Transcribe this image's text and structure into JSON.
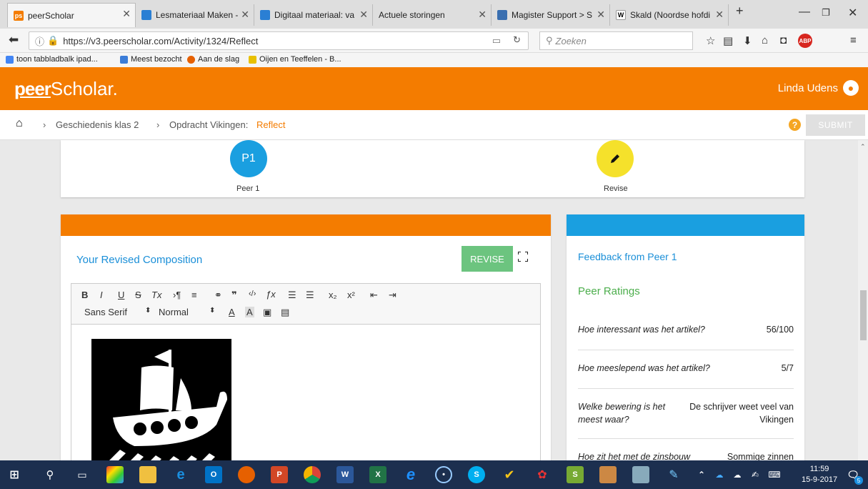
{
  "browser": {
    "tabs": [
      {
        "label": "peerScholar",
        "icon_color": "#f47c00",
        "icon_text": "ps",
        "active": true
      },
      {
        "label": "Lesmateriaal Maken -",
        "icon_color": "#2a7fd4",
        "icon_text": "",
        "active": false
      },
      {
        "label": "Digitaal materiaal: va",
        "icon_color": "#2a7fd4",
        "icon_text": "",
        "active": false
      },
      {
        "label": "Actuele storingen",
        "icon_color": "",
        "icon_text": "",
        "active": false
      },
      {
        "label": "Magister Support > S",
        "icon_color": "#3a6fb0",
        "icon_text": "",
        "active": false
      },
      {
        "label": "Skald (Noordse hofdi",
        "icon_color": "#ffffff",
        "icon_text": "W",
        "active": false
      }
    ],
    "new_tab_label": "+",
    "url": "https://v3.peerscholar.com/Activity/1324/Reflect",
    "url_domain": "peerscholar.com",
    "search_placeholder": "Zoeken",
    "bookmarks": [
      {
        "label": "toon tabbladbalk ipad...",
        "icon_color": "#4285f4"
      },
      {
        "label": "Meest bezocht",
        "icon_color": "#3b7dd8"
      },
      {
        "label": "Aan de slag",
        "icon_color": "#e66000"
      },
      {
        "label": "Oijen en Teeffelen - B...",
        "icon_color": "#e8c000"
      }
    ]
  },
  "app": {
    "logo_peer": "peer",
    "logo_scholar": "Scholar.",
    "user_name": "Linda Udens",
    "brand_color": "#f47c00",
    "breadcrumb": {
      "home_icon": "home-icon",
      "course": "Geschiedenis klas 2",
      "assignment": "Opdracht Vikingen:",
      "stage": "Reflect"
    },
    "submit_label": "SUBMIT",
    "steps": [
      {
        "badge": "P1",
        "label": "Peer 1",
        "color": "#1a9fe0"
      },
      {
        "badge": "pencil-icon",
        "label": "Revise",
        "color": "#f5e12b"
      }
    ],
    "composition": {
      "title": "Your Revised Composition",
      "revise_label": "REVISE",
      "toolbar_row1": [
        "B",
        "I",
        "U",
        "S",
        "Tx",
        "¶",
        "≡",
        "link",
        "quote",
        "code",
        "fx",
        "ol",
        "ul",
        "x₂",
        "x²",
        "outdent",
        "indent"
      ],
      "font_family": "Sans Serif",
      "font_size": "Normal"
    },
    "feedback": {
      "title": "Feedback from Peer 1",
      "ratings_title": "Peer Ratings",
      "ratings": [
        {
          "question": "Hoe interessant was het artikel?",
          "answer": "56/100"
        },
        {
          "question": "Hoe meeslepend was het artikel?",
          "answer": "5/7"
        },
        {
          "question": "Welke bewering is het meest waar?",
          "answer": "De schrijver weet veel van Vikingen"
        },
        {
          "question": "Hoe zit het met de zinsbouw van het artikel?",
          "answer": "Sommige zinnen klopten niet"
        }
      ]
    }
  },
  "taskbar": {
    "time": "11:59",
    "date": "15-9-2017",
    "notification_count": "5"
  }
}
